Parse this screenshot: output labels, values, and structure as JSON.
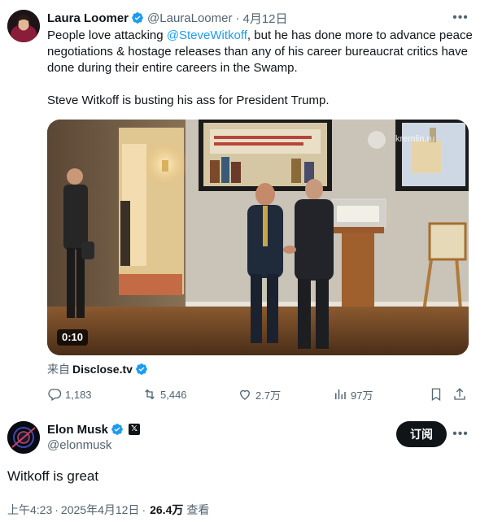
{
  "tweet": {
    "author_name": "Laura Loomer",
    "handle": "@LauraLoomer",
    "date": "4月12日",
    "text_line1_pre": "People love attacking ",
    "text_mention": "@SteveWitkoff",
    "text_line1_post": ", but he has done more to advance peace negotiations & hostage releases than any of his career bureaucrat critics have done during their entire careers in the Swamp.",
    "text_para2": "Steve Witkoff is busting his ass for President Trump.",
    "video_duration": "0:10",
    "video_overlay_text": "kremlin.ru",
    "source_prefix": "来自",
    "source_name": "Disclose.tv",
    "stats": {
      "replies": "1,183",
      "retweets": "5,446",
      "likes": "2.7万",
      "views": "97万"
    }
  },
  "reply": {
    "author_name": "Elon Musk",
    "handle": "@elonmusk",
    "subscribe_label": "订阅",
    "text": "Witkoff is great",
    "time": "上午4:23",
    "date": "2025年4月12日",
    "views_count": "26.4万",
    "views_label": "查看"
  },
  "colors": {
    "accent": "#1d9bf0",
    "text_primary": "#0f1419",
    "text_secondary": "#536471"
  },
  "icons": [
    "verified-icon",
    "more-icon",
    "reply-icon",
    "retweet-icon",
    "like-icon",
    "views-icon",
    "bookmark-icon",
    "share-icon",
    "x-affiliate-icon"
  ]
}
